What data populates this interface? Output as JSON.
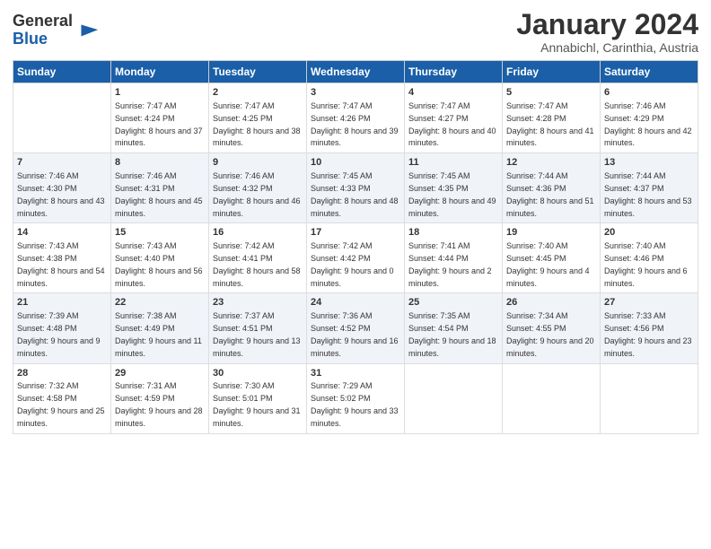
{
  "header": {
    "logo_line1": "General",
    "logo_line2": "Blue",
    "month": "January 2024",
    "location": "Annabichl, Carinthia, Austria"
  },
  "days_of_week": [
    "Sunday",
    "Monday",
    "Tuesday",
    "Wednesday",
    "Thursday",
    "Friday",
    "Saturday"
  ],
  "weeks": [
    [
      {
        "day": "",
        "sunrise": "",
        "sunset": "",
        "daylight": ""
      },
      {
        "day": "1",
        "sunrise": "Sunrise: 7:47 AM",
        "sunset": "Sunset: 4:24 PM",
        "daylight": "Daylight: 8 hours and 37 minutes."
      },
      {
        "day": "2",
        "sunrise": "Sunrise: 7:47 AM",
        "sunset": "Sunset: 4:25 PM",
        "daylight": "Daylight: 8 hours and 38 minutes."
      },
      {
        "day": "3",
        "sunrise": "Sunrise: 7:47 AM",
        "sunset": "Sunset: 4:26 PM",
        "daylight": "Daylight: 8 hours and 39 minutes."
      },
      {
        "day": "4",
        "sunrise": "Sunrise: 7:47 AM",
        "sunset": "Sunset: 4:27 PM",
        "daylight": "Daylight: 8 hours and 40 minutes."
      },
      {
        "day": "5",
        "sunrise": "Sunrise: 7:47 AM",
        "sunset": "Sunset: 4:28 PM",
        "daylight": "Daylight: 8 hours and 41 minutes."
      },
      {
        "day": "6",
        "sunrise": "Sunrise: 7:46 AM",
        "sunset": "Sunset: 4:29 PM",
        "daylight": "Daylight: 8 hours and 42 minutes."
      }
    ],
    [
      {
        "day": "7",
        "sunrise": "Sunrise: 7:46 AM",
        "sunset": "Sunset: 4:30 PM",
        "daylight": "Daylight: 8 hours and 43 minutes."
      },
      {
        "day": "8",
        "sunrise": "Sunrise: 7:46 AM",
        "sunset": "Sunset: 4:31 PM",
        "daylight": "Daylight: 8 hours and 45 minutes."
      },
      {
        "day": "9",
        "sunrise": "Sunrise: 7:46 AM",
        "sunset": "Sunset: 4:32 PM",
        "daylight": "Daylight: 8 hours and 46 minutes."
      },
      {
        "day": "10",
        "sunrise": "Sunrise: 7:45 AM",
        "sunset": "Sunset: 4:33 PM",
        "daylight": "Daylight: 8 hours and 48 minutes."
      },
      {
        "day": "11",
        "sunrise": "Sunrise: 7:45 AM",
        "sunset": "Sunset: 4:35 PM",
        "daylight": "Daylight: 8 hours and 49 minutes."
      },
      {
        "day": "12",
        "sunrise": "Sunrise: 7:44 AM",
        "sunset": "Sunset: 4:36 PM",
        "daylight": "Daylight: 8 hours and 51 minutes."
      },
      {
        "day": "13",
        "sunrise": "Sunrise: 7:44 AM",
        "sunset": "Sunset: 4:37 PM",
        "daylight": "Daylight: 8 hours and 53 minutes."
      }
    ],
    [
      {
        "day": "14",
        "sunrise": "Sunrise: 7:43 AM",
        "sunset": "Sunset: 4:38 PM",
        "daylight": "Daylight: 8 hours and 54 minutes."
      },
      {
        "day": "15",
        "sunrise": "Sunrise: 7:43 AM",
        "sunset": "Sunset: 4:40 PM",
        "daylight": "Daylight: 8 hours and 56 minutes."
      },
      {
        "day": "16",
        "sunrise": "Sunrise: 7:42 AM",
        "sunset": "Sunset: 4:41 PM",
        "daylight": "Daylight: 8 hours and 58 minutes."
      },
      {
        "day": "17",
        "sunrise": "Sunrise: 7:42 AM",
        "sunset": "Sunset: 4:42 PM",
        "daylight": "Daylight: 9 hours and 0 minutes."
      },
      {
        "day": "18",
        "sunrise": "Sunrise: 7:41 AM",
        "sunset": "Sunset: 4:44 PM",
        "daylight": "Daylight: 9 hours and 2 minutes."
      },
      {
        "day": "19",
        "sunrise": "Sunrise: 7:40 AM",
        "sunset": "Sunset: 4:45 PM",
        "daylight": "Daylight: 9 hours and 4 minutes."
      },
      {
        "day": "20",
        "sunrise": "Sunrise: 7:40 AM",
        "sunset": "Sunset: 4:46 PM",
        "daylight": "Daylight: 9 hours and 6 minutes."
      }
    ],
    [
      {
        "day": "21",
        "sunrise": "Sunrise: 7:39 AM",
        "sunset": "Sunset: 4:48 PM",
        "daylight": "Daylight: 9 hours and 9 minutes."
      },
      {
        "day": "22",
        "sunrise": "Sunrise: 7:38 AM",
        "sunset": "Sunset: 4:49 PM",
        "daylight": "Daylight: 9 hours and 11 minutes."
      },
      {
        "day": "23",
        "sunrise": "Sunrise: 7:37 AM",
        "sunset": "Sunset: 4:51 PM",
        "daylight": "Daylight: 9 hours and 13 minutes."
      },
      {
        "day": "24",
        "sunrise": "Sunrise: 7:36 AM",
        "sunset": "Sunset: 4:52 PM",
        "daylight": "Daylight: 9 hours and 16 minutes."
      },
      {
        "day": "25",
        "sunrise": "Sunrise: 7:35 AM",
        "sunset": "Sunset: 4:54 PM",
        "daylight": "Daylight: 9 hours and 18 minutes."
      },
      {
        "day": "26",
        "sunrise": "Sunrise: 7:34 AM",
        "sunset": "Sunset: 4:55 PM",
        "daylight": "Daylight: 9 hours and 20 minutes."
      },
      {
        "day": "27",
        "sunrise": "Sunrise: 7:33 AM",
        "sunset": "Sunset: 4:56 PM",
        "daylight": "Daylight: 9 hours and 23 minutes."
      }
    ],
    [
      {
        "day": "28",
        "sunrise": "Sunrise: 7:32 AM",
        "sunset": "Sunset: 4:58 PM",
        "daylight": "Daylight: 9 hours and 25 minutes."
      },
      {
        "day": "29",
        "sunrise": "Sunrise: 7:31 AM",
        "sunset": "Sunset: 4:59 PM",
        "daylight": "Daylight: 9 hours and 28 minutes."
      },
      {
        "day": "30",
        "sunrise": "Sunrise: 7:30 AM",
        "sunset": "Sunset: 5:01 PM",
        "daylight": "Daylight: 9 hours and 31 minutes."
      },
      {
        "day": "31",
        "sunrise": "Sunrise: 7:29 AM",
        "sunset": "Sunset: 5:02 PM",
        "daylight": "Daylight: 9 hours and 33 minutes."
      },
      {
        "day": "",
        "sunrise": "",
        "sunset": "",
        "daylight": ""
      },
      {
        "day": "",
        "sunrise": "",
        "sunset": "",
        "daylight": ""
      },
      {
        "day": "",
        "sunrise": "",
        "sunset": "",
        "daylight": ""
      }
    ]
  ]
}
